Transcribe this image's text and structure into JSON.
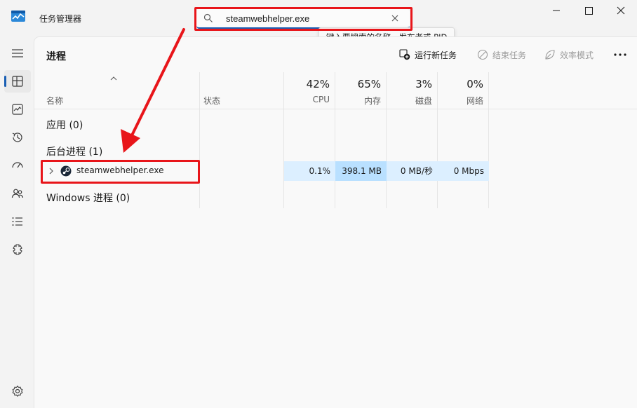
{
  "window": {
    "title": "任务管理器",
    "accent_color": "#1a5fb4",
    "annotation_color": "#e8151a"
  },
  "search": {
    "value": "steamwebhelper.exe",
    "tooltip": "键入要搜索的名称、发布者或 PID"
  },
  "page": {
    "title": "进程"
  },
  "toolbar": {
    "run_new_task": "运行新任务",
    "end_task": "结束任务",
    "efficiency_mode": "效率模式"
  },
  "sidebar": {
    "items": [
      "menu-icon",
      "processes-icon",
      "performance-icon",
      "app-history-icon",
      "startup-apps-icon",
      "users-icon",
      "details-icon",
      "services-icon",
      "settings-icon"
    ]
  },
  "table": {
    "columns": {
      "name": "名称",
      "status": "状态",
      "cpu": {
        "pct": "42%",
        "label": "CPU"
      },
      "memory": {
        "pct": "65%",
        "label": "内存"
      },
      "disk": {
        "pct": "3%",
        "label": "磁盘"
      },
      "network": {
        "pct": "0%",
        "label": "网络"
      }
    },
    "groups": {
      "apps": "应用 (0)",
      "background": "后台进程 (1)",
      "windows": "Windows 进程 (0)"
    },
    "process": {
      "name": "steamwebhelper.exe",
      "cpu": "0.1%",
      "memory": "398.1 MB",
      "disk": "0 MB/秒",
      "network": "0 Mbps"
    }
  }
}
